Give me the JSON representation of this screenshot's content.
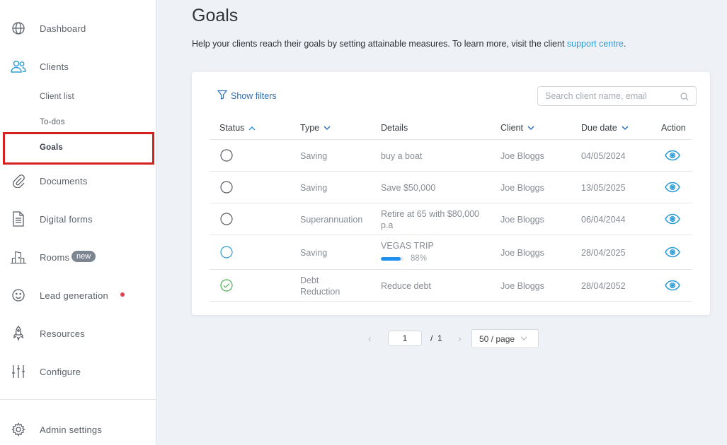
{
  "sidebar": {
    "items": [
      {
        "label": "Dashboard",
        "icon": "globe-icon"
      },
      {
        "label": "Clients",
        "icon": "users-icon"
      },
      {
        "label": "Documents",
        "icon": "paperclip-icon"
      },
      {
        "label": "Digital forms",
        "icon": "document-icon"
      },
      {
        "label": "Rooms",
        "icon": "building-icon"
      },
      {
        "label": "Lead generation",
        "icon": "smiley-icon"
      },
      {
        "label": "Resources",
        "icon": "rocket-icon"
      },
      {
        "label": "Configure",
        "icon": "sliders-icon"
      },
      {
        "label": "Admin settings",
        "icon": "gear-icon"
      }
    ],
    "sub_items": [
      {
        "label": "Client list"
      },
      {
        "label": "To-dos"
      },
      {
        "label": "Goals",
        "active": true
      }
    ],
    "rooms_badge": "new",
    "accent_color": "#2d9bd4",
    "highlight_color": "#d61f1f"
  },
  "page": {
    "title": "Goals",
    "intro_text": "Help your clients reach their goals by setting attainable measures. To learn more, visit the client ",
    "intro_link": "support centre",
    "intro_end": "."
  },
  "toolbar": {
    "show_filters": "Show filters",
    "search_placeholder": "Search client name, email"
  },
  "table": {
    "columns": [
      "Status",
      "Type",
      "Details",
      "Client",
      "Due date",
      "Action"
    ],
    "rows": [
      {
        "status": "open",
        "type": "Saving",
        "details": "buy a boat",
        "client": "Joe Bloggs",
        "due": "04/05/2024"
      },
      {
        "status": "open",
        "type": "Saving",
        "details": "Save $50,000",
        "client": "Joe Bloggs",
        "due": "13/05/2025"
      },
      {
        "status": "open",
        "type": "Superannuation",
        "details": "Retire at 65 with $80,000 p.a",
        "client": "Joe Bloggs",
        "due": "06/04/2044"
      },
      {
        "status": "in-progress",
        "type": "Saving",
        "details": "VEGAS TRIP",
        "progress": 0.88,
        "progress_label": "88%",
        "client": "Joe Bloggs",
        "due": "28/04/2025"
      },
      {
        "status": "complete",
        "type": "Debt Reduction",
        "details": "Reduce debt",
        "client": "Joe Bloggs",
        "due": "28/04/2052"
      }
    ]
  },
  "pagination": {
    "current": "1",
    "separator": "/",
    "total": "1",
    "page_size": "50 / page"
  }
}
